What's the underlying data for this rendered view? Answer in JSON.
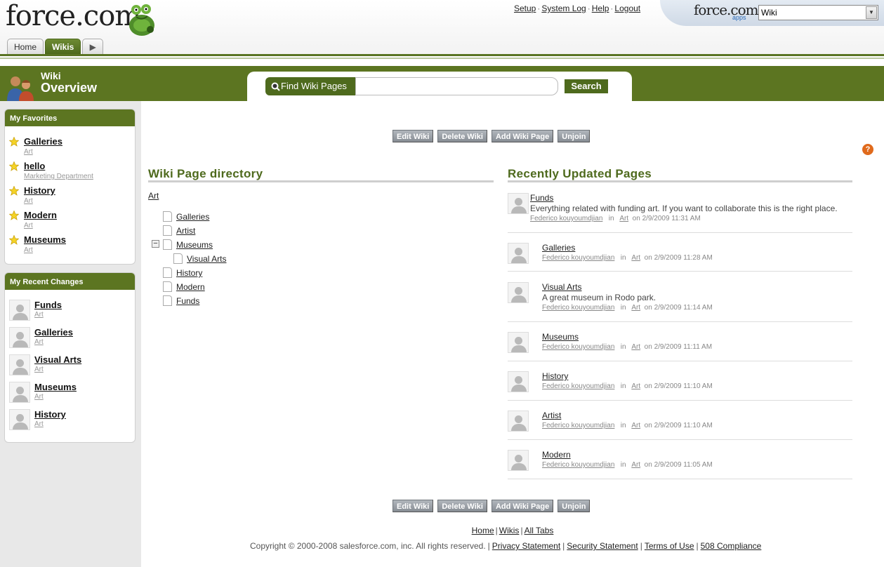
{
  "header": {
    "logo_text": "force.com",
    "tabs": [
      "Home",
      "Wikis"
    ],
    "links": [
      "Setup",
      "System Log",
      "Help",
      "Logout"
    ],
    "app_logo": "force.com",
    "app_sub": "apps",
    "app_selected": "Wiki"
  },
  "titlebar": {
    "small": "Wiki",
    "big": "Overview",
    "search_label": "Find Wiki Pages",
    "search_value": "",
    "search_button": "Search",
    "help_link": "Help for this page",
    "help_icon_glyph": "?"
  },
  "sidebar": {
    "favorites_title": "My Favorites",
    "favorites": [
      {
        "title": "Galleries",
        "sub": "Art"
      },
      {
        "title": "hello",
        "sub": "Marketing Department"
      },
      {
        "title": "History",
        "sub": "Art"
      },
      {
        "title": "Modern",
        "sub": "Art"
      },
      {
        "title": "Museums",
        "sub": "Art"
      }
    ],
    "recent_title": "My Recent Changes",
    "recent": [
      {
        "title": "Funds",
        "sub": "Art"
      },
      {
        "title": "Galleries",
        "sub": "Art"
      },
      {
        "title": "Visual Arts",
        "sub": "Art"
      },
      {
        "title": "Museums",
        "sub": "Art"
      },
      {
        "title": "History",
        "sub": "Art"
      }
    ]
  },
  "buttons": [
    "Edit Wiki",
    "Delete Wiki",
    "Add Wiki Page",
    "Unjoin"
  ],
  "directory": {
    "title": "Wiki Page directory",
    "root": "Art",
    "collapse_glyph": "−",
    "pages": [
      "Galleries",
      "Artist",
      "Museums",
      "Visual Arts",
      "History",
      "Modern",
      "Funds"
    ]
  },
  "recent_updates": {
    "title": "Recently Updated Pages",
    "in_word": "in",
    "items": [
      {
        "title": "Funds",
        "desc": "Everything related with funding art. If you want to collaborate this is the right place.",
        "user": "Federico kouyoumdjian",
        "wiki": "Art",
        "date": "on 2/9/2009 11:31 AM"
      },
      {
        "title": "Galleries",
        "desc": "",
        "user": "Federico kouyoumdjian",
        "wiki": "Art",
        "date": "on 2/9/2009 11:28 AM"
      },
      {
        "title": "Visual Arts",
        "desc": "A great museum in Rodo park.",
        "user": "Federico kouyoumdjian",
        "wiki": "Art",
        "date": "on 2/9/2009 11:14 AM"
      },
      {
        "title": "Museums",
        "desc": "",
        "user": "Federico kouyoumdjian",
        "wiki": "Art",
        "date": "on 2/9/2009 11:11 AM"
      },
      {
        "title": "History",
        "desc": "",
        "user": "Federico kouyoumdjian",
        "wiki": "Art",
        "date": "on 2/9/2009 11:10 AM"
      },
      {
        "title": "Artist",
        "desc": "",
        "user": "Federico kouyoumdjian",
        "wiki": "Art",
        "date": "on 2/9/2009 11:10 AM"
      },
      {
        "title": "Modern",
        "desc": "",
        "user": "Federico kouyoumdjian",
        "wiki": "Art",
        "date": "on 2/9/2009 11:05 AM"
      }
    ]
  },
  "footer": {
    "links": [
      "Home",
      "Wikis",
      "All Tabs"
    ],
    "copyright": "Copyright © 2000-2008 salesforce.com, inc. All rights reserved.",
    "legal": [
      "Privacy Statement",
      "Security Statement",
      "Terms of Use",
      "508 Compliance"
    ]
  },
  "colors": {
    "brand_green": "#5c7521",
    "dark_green": "#4e6a1d",
    "button_gray": "#878d94",
    "help_orange": "#e06a1c"
  }
}
